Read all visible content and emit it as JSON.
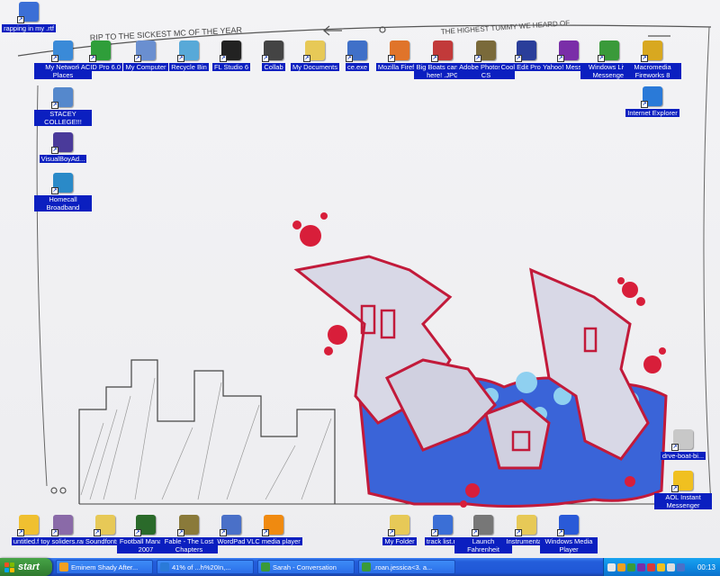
{
  "wallpaper": {
    "top_text": "RIP TO THE SICKEST MC OF THE YEAR",
    "top_right_text": "THE HIGHEST TUMMY WE HEARD OF"
  },
  "icons": [
    {
      "id": "rapping-rtf",
      "label": "rapping in my .rtf",
      "icon": "document-icon",
      "color": "#3b6fd6",
      "col": 0,
      "row": 0
    },
    {
      "id": "my-network-places",
      "label": "My Network Places",
      "icon": "network-icon",
      "color": "#3a8ad8"
    },
    {
      "id": "acid-pro",
      "label": "ACID Pro 6.0",
      "icon": "acid-icon",
      "color": "#2f9e3a"
    },
    {
      "id": "my-computer",
      "label": "My Computer",
      "icon": "computer-icon",
      "color": "#6a8fd0"
    },
    {
      "id": "recycle-bin",
      "label": "Recycle Bin",
      "icon": "recycle-bin-icon",
      "color": "#58a9d8"
    },
    {
      "id": "fl-studio",
      "label": "FL Studio 6",
      "icon": "fl-studio-icon",
      "color": "#222222"
    },
    {
      "id": "collab",
      "label": "Collab",
      "icon": "collab-icon",
      "color": "#444444"
    },
    {
      "id": "my-documents",
      "label": "My Documents",
      "icon": "folder-icon",
      "color": "#e7c957"
    },
    {
      "id": "ce-exe",
      "label": "ce.exe",
      "icon": "computer-icon",
      "color": "#4070c8"
    },
    {
      "id": "mozilla-firefox",
      "label": "Mozilla Firefox",
      "icon": "firefox-icon",
      "color": "#e0742a"
    },
    {
      "id": "big-boats",
      "label": "Big Boats can get here! .JPG",
      "icon": "image-icon",
      "color": "#c23a3a"
    },
    {
      "id": "photoshop",
      "label": "Adobe Photoshop CS",
      "icon": "photoshop-icon",
      "color": "#7a6a3a"
    },
    {
      "id": "cool-edit",
      "label": "Cool Edit Pro 2.1",
      "icon": "cool-edit-icon",
      "color": "#2a3e9a"
    },
    {
      "id": "yahoo-messenger",
      "label": "Yahoo! Messen...",
      "icon": "yahoo-icon",
      "color": "#7a2ea8"
    },
    {
      "id": "windows-live-messenger",
      "label": "Windows Live Messenger",
      "icon": "messenger-icon",
      "color": "#3a9a3a"
    },
    {
      "id": "macromedia-fireworks",
      "label": "Macromedia Fireworks 8",
      "icon": "fireworks-icon",
      "color": "#d8a820"
    },
    {
      "id": "internet-explorer",
      "label": "Internet Explorer",
      "icon": "ie-icon",
      "color": "#2a7ad8"
    },
    {
      "id": "stacey-college",
      "label": "STACEY COLLEGE!!!",
      "icon": "shortcut-icon",
      "color": "#5588cc"
    },
    {
      "id": "visualboyadvance",
      "label": "VisualBoyAd...",
      "icon": "gameboy-icon",
      "color": "#4a3a9a"
    },
    {
      "id": "homecall-broadband",
      "label": "Homecall Broadband",
      "icon": "globe-icon",
      "color": "#2a8ac8"
    },
    {
      "id": "drive-boat",
      "label": "drve-boat-bi...",
      "icon": "document-icon",
      "color": "#c8c8c8"
    },
    {
      "id": "aol-instant-messenger",
      "label": "AOL Instant Messenger",
      "icon": "aim-icon",
      "color": "#f0c020"
    },
    {
      "id": "untitled-flp",
      "label": "untitled.flp",
      "icon": "fl-file-icon",
      "color": "#f0c030"
    },
    {
      "id": "toy-soldiers",
      "label": "toy soliders.rar",
      "icon": "archive-icon",
      "color": "#8a6aa8"
    },
    {
      "id": "soundfonts",
      "label": "Soundfonts...",
      "icon": "folder-icon",
      "color": "#e7c957"
    },
    {
      "id": "football-manager",
      "label": "Football Manager 2007",
      "icon": "football-icon",
      "color": "#2a6a2a"
    },
    {
      "id": "fable",
      "label": "Fable - The Lost Chapters",
      "icon": "fable-icon",
      "color": "#8a7a3a"
    },
    {
      "id": "wordpad",
      "label": "WordPad",
      "icon": "wordpad-icon",
      "color": "#4a70c8"
    },
    {
      "id": "vlc",
      "label": "VLC media player",
      "icon": "vlc-icon",
      "color": "#f08a10"
    },
    {
      "id": "my-folder",
      "label": "My Folder",
      "icon": "folder-icon",
      "color": "#e7c957"
    },
    {
      "id": "track-list",
      "label": "track list.rtf",
      "icon": "document-icon",
      "color": "#3b6fd6"
    },
    {
      "id": "launch-fahrenheit",
      "label": "Launch Fahrenheit",
      "icon": "shortcut-icon",
      "color": "#777777"
    },
    {
      "id": "instrumentals",
      "label": "Instrumentals",
      "icon": "folder-icon",
      "color": "#e7c957"
    },
    {
      "id": "windows-media-player",
      "label": "Windows Media Player",
      "icon": "media-player-icon",
      "color": "#2a5ad8"
    }
  ],
  "taskbar": {
    "start_label": "start",
    "tasks": [
      {
        "label": "Eminem Shady After...",
        "icon": "winamp-icon",
        "color": "#f0a020"
      },
      {
        "label": "41% of ...h%20In,...",
        "icon": "ie-icon",
        "color": "#2a7ad8"
      },
      {
        "label": "Sarah - Conversation",
        "icon": "messenger-icon",
        "color": "#3a9a3a"
      },
      {
        "label": ".roan.jessica<3.  a...",
        "icon": "messenger-icon",
        "color": "#3a9a3a"
      }
    ],
    "clock": "00:13"
  }
}
